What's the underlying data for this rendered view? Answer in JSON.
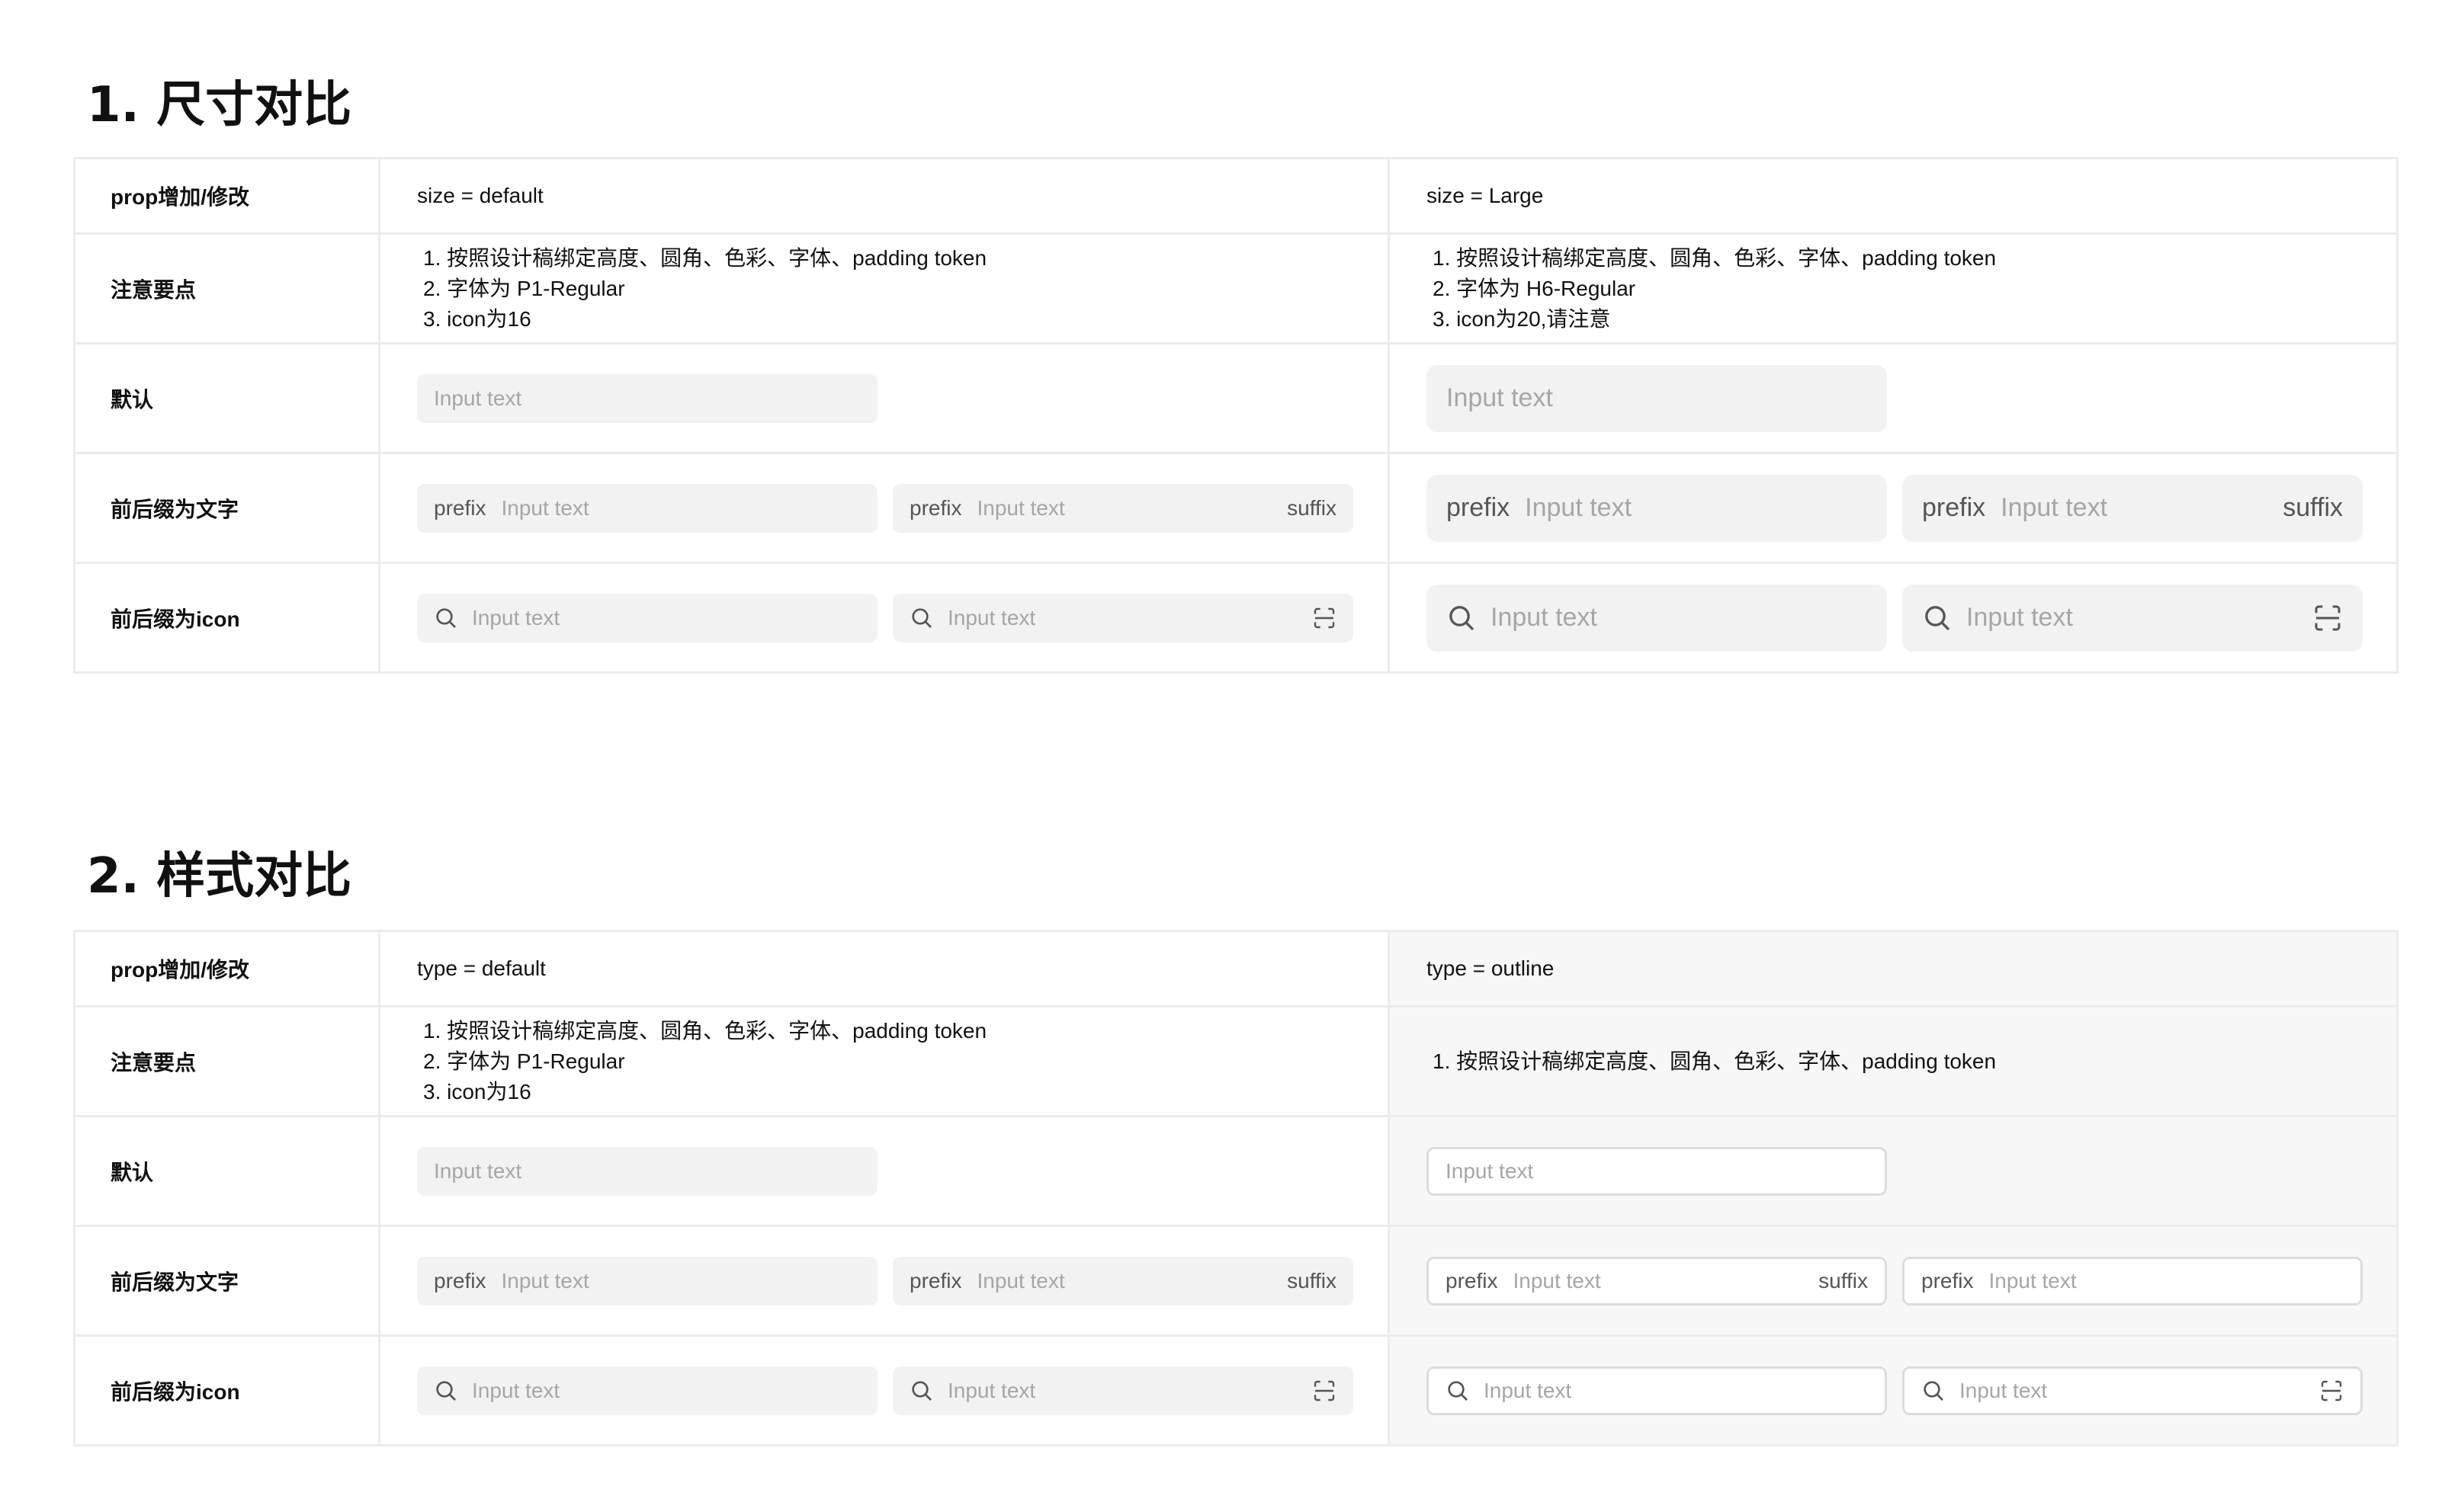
{
  "sections": [
    {
      "title": "1. 尺寸对比",
      "header": {
        "label": "prop增加/修改",
        "col2": "size = default",
        "col3": "size = Large"
      },
      "row_labels": {
        "notes": "注意要点",
        "default": "默认",
        "text_affix": "前后缀为文字",
        "icon_affix": "前后缀为icon"
      },
      "col2_notes": [
        "按照设计稿绑定高度、圆角、色彩、字体、padding token",
        "字体为 P1-Regular",
        "icon为16"
      ],
      "col3_notes": [
        "按照设计稿绑定高度、圆角、色彩、字体、padding token",
        "字体为 H6-Regular",
        "icon为20,请注意"
      ]
    },
    {
      "title": "2. 样式对比",
      "header": {
        "label": "prop增加/修改",
        "col2": "type = default",
        "col3": "type = outline"
      },
      "row_labels": {
        "notes": "注意要点",
        "default": "默认",
        "text_affix": "前后缀为文字",
        "icon_affix": "前后缀为icon"
      },
      "col2_notes": [
        "按照设计稿绑定高度、圆角、色彩、字体、padding token",
        "字体为 P1-Regular",
        "icon为16"
      ],
      "col3_notes": [
        "按照设计稿绑定高度、圆角、色彩、字体、padding token"
      ]
    }
  ],
  "input": {
    "placeholder": "Input text",
    "prefix": "prefix",
    "suffix": "suffix"
  },
  "icons": {
    "prefix_icon": "search-icon",
    "suffix_icon": "scan-icon"
  },
  "colors": {
    "filled_bg": "#f2f2f2",
    "outline_border": "#dcdcdc",
    "placeholder": "#a6a6a6",
    "grid_line": "#ececec"
  }
}
